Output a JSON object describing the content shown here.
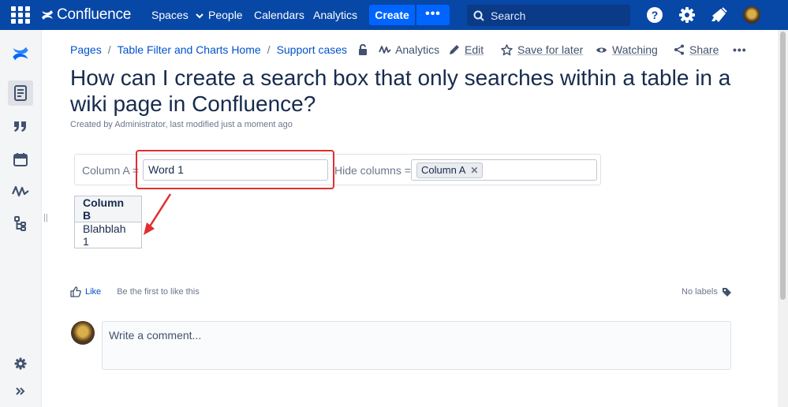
{
  "topnav": {
    "logo": "Confluence",
    "items": [
      {
        "label": "Spaces",
        "has_dropdown": true
      },
      {
        "label": "People"
      },
      {
        "label": "Calendars"
      },
      {
        "label": "Analytics"
      }
    ],
    "create_label": "Create",
    "more_label": "•••",
    "search_placeholder": "Search",
    "colors": {
      "bar": "#0747a6",
      "create": "#0065ff"
    }
  },
  "sidebar": {
    "items": [
      "confluence-logo-icon",
      "pages-icon",
      "blog-quote-icon",
      "calendar-icon",
      "analytics-icon",
      "page-tree-icon",
      "settings-gear-icon",
      "expand-chevron-icon"
    ]
  },
  "breadcrumb": {
    "items": [
      "Pages",
      "Table Filter and Charts Home",
      "Support cases"
    ],
    "analytics_label": "Analytics"
  },
  "actions": {
    "edit": "Edit",
    "save_for_later": "Save for later",
    "watching": "Watching",
    "share": "Share",
    "more": "•••"
  },
  "page": {
    "title": "How can I create a search box that only searches within a table in a wiki page in Confluence?",
    "byline": "Created by Administrator, last modified just a moment ago"
  },
  "filter": {
    "column_a_label": "Column A =",
    "column_a_value": "Word 1",
    "hide_columns_label": "Hide columns =",
    "hide_columns_tag": "Column A",
    "highlight_color": "#e02f2f"
  },
  "table": {
    "headers": [
      "Column B"
    ],
    "rows": [
      [
        "Blahblah 1"
      ]
    ]
  },
  "footer": {
    "like": "Like",
    "first_like": "Be the first to like this",
    "no_labels": "No labels",
    "comment_placeholder": "Write a comment..."
  }
}
